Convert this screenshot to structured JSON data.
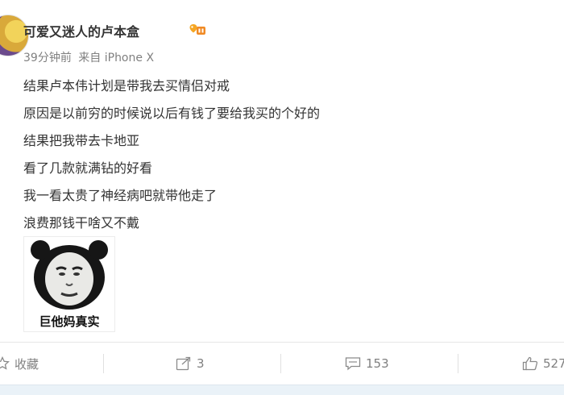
{
  "post": {
    "username": "可爱又迷人的卢本盒",
    "time": "39分钟前",
    "source": "来自 iPhone X",
    "lines": [
      "结果卢本伟计划是带我去买情侣对戒",
      "原因是以前穷的时候说以后有钱了要给我买的个好的",
      "结果把我带去卡地亚",
      "看了几款就满钻的好看",
      "我一看太贵了神经病吧就带他走了",
      "浪费那钱干啥又不戴"
    ],
    "sticker_caption": "巨他妈真实"
  },
  "actions": {
    "favorite_label": "收藏",
    "repost_count": "3",
    "comment_count": "153",
    "like_count": "527"
  }
}
